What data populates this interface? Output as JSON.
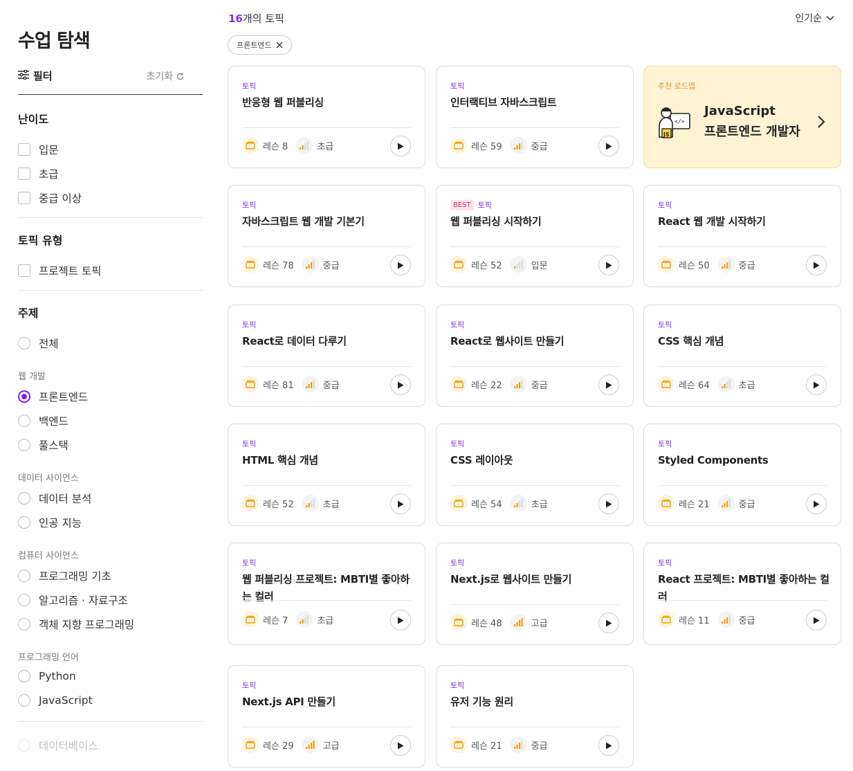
{
  "sidebar": {
    "title": "수업 탐색",
    "filter_label": "필터",
    "reset_label": "초기화",
    "difficulty": {
      "title": "난이도",
      "options": [
        "입문",
        "초급",
        "중급 이상"
      ]
    },
    "topic_type": {
      "title": "토픽 유형",
      "options": [
        "프로젝트 토픽"
      ]
    },
    "subject": {
      "title": "주제",
      "all_label": "전체",
      "groups": [
        {
          "label": "웹 개발",
          "options": [
            "프론트엔드",
            "백엔드",
            "풀스택"
          ]
        },
        {
          "label": "데이터 사이언스",
          "options": [
            "데이터 분석",
            "인공 지능"
          ]
        },
        {
          "label": "컴퓨터 사이언스",
          "options": [
            "프로그래밍 기초",
            "알고리즘 · 자료구조",
            "객체 지향 프로그래밍"
          ]
        },
        {
          "label": "프로그래밍 언어",
          "options": [
            "Python",
            "JavaScript"
          ]
        }
      ],
      "selected": "프론트엔드",
      "faded_option": "데이터베이스"
    }
  },
  "main": {
    "count_number": "16",
    "count_suffix": "개의 토픽",
    "sort_label": "인기순",
    "chip_label": "프론트엔드",
    "roadmap": {
      "label": "추천 로드맵",
      "line1": "JavaScript",
      "line2": "프론트엔드 개발자"
    },
    "cards": [
      {
        "tag": "토픽",
        "title": "반응형 웹 퍼블리싱",
        "lesson": "레슨 8",
        "level": "초급"
      },
      {
        "tag": "토픽",
        "title": "인터랙티브 자바스크립트",
        "lesson": "레슨 59",
        "level": "중급"
      },
      {
        "tag": "토픽",
        "title": "자바스크립트 웹 개발 기본기",
        "lesson": "레슨 78",
        "level": "중급"
      },
      {
        "best": "BEST",
        "tag": "토픽",
        "title": "웹 퍼블리싱 시작하기",
        "lesson": "레슨 52",
        "level": "입문"
      },
      {
        "tag": "토픽",
        "title": "React 웹 개발 시작하기",
        "lesson": "레슨 50",
        "level": "중급"
      },
      {
        "tag": "토픽",
        "title": "React로 데이터 다루기",
        "lesson": "레슨 81",
        "level": "중급"
      },
      {
        "tag": "토픽",
        "title": "React로 웹사이트 만들기",
        "lesson": "레슨 22",
        "level": "중급"
      },
      {
        "tag": "토픽",
        "title": "CSS 핵심 개념",
        "lesson": "레슨 64",
        "level": "초급"
      },
      {
        "tag": "토픽",
        "title": "HTML 핵심 개념",
        "lesson": "레슨 52",
        "level": "초급"
      },
      {
        "tag": "토픽",
        "title": "CSS 레이아웃",
        "lesson": "레슨 54",
        "level": "초급"
      },
      {
        "tag": "토픽",
        "title": "Styled Components",
        "lesson": "레슨 21",
        "level": "중급"
      },
      {
        "tag": "토픽",
        "title": "웹 퍼블리싱 프로젝트: MBTI별 좋아하는 컬러",
        "lesson": "레슨 7",
        "level": "초급"
      },
      {
        "tag": "토픽",
        "title": "Next.js로 웹사이트 만들기",
        "lesson": "레슨 48",
        "level": "고급"
      },
      {
        "tag": "토픽",
        "title": "React 프로젝트: MBTI별 좋아하는 컬러",
        "lesson": "레슨 11",
        "level": "중급"
      },
      {
        "tag": "토픽",
        "title": "Next.js API 만들기",
        "lesson": "레슨 29",
        "level": "고급"
      },
      {
        "tag": "토픽",
        "title": "유저 기능 원리",
        "lesson": "레슨 21",
        "level": "중급"
      }
    ]
  },
  "colors": {
    "accent": "#7c1fe6",
    "topic_tag": "#8a2be2",
    "best_tag": "#d6336c",
    "roadmap_bg": "#fff3d4",
    "level_bar": "#f59f00"
  }
}
